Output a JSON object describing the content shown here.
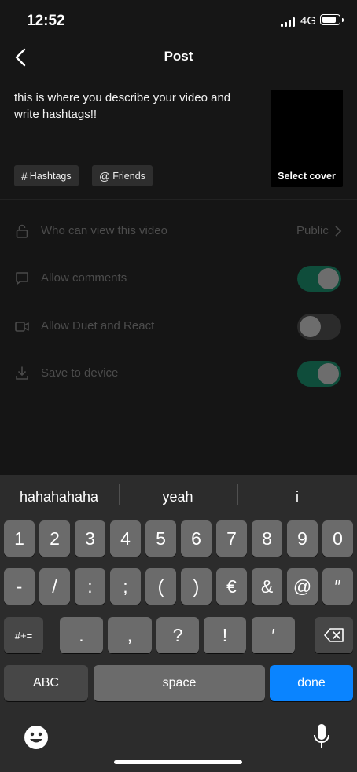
{
  "status_bar": {
    "time": "12:52",
    "network": "4G"
  },
  "header": {
    "title": "Post"
  },
  "description": "this is where you describe your video and write hashtags!!",
  "cover": {
    "label": "Select cover"
  },
  "chips": {
    "hashtags": {
      "symbol": "#",
      "label": "Hashtags"
    },
    "friends": {
      "symbol": "@",
      "label": "Friends"
    }
  },
  "settings": {
    "who_can_view": {
      "label": "Who can view this video",
      "value": "Public"
    },
    "allow_comments": {
      "label": "Allow comments",
      "on": true
    },
    "allow_duet": {
      "label": "Allow Duet and React",
      "on": false
    },
    "save_device": {
      "label": "Save to device",
      "on": true
    }
  },
  "keyboard": {
    "suggestions": [
      "hahahahaha",
      "yeah",
      "i"
    ],
    "row1": [
      "1",
      "2",
      "3",
      "4",
      "5",
      "6",
      "7",
      "8",
      "9",
      "0"
    ],
    "row2": [
      "-",
      "/",
      ":",
      ";",
      "(",
      ")",
      "€",
      "&",
      "@",
      "″"
    ],
    "row3": [
      ".",
      ",",
      "?",
      "!",
      "′"
    ],
    "symbols_key": "#+=",
    "abc_key": "ABC",
    "space_key": "space",
    "done_key": "done"
  },
  "colors": {
    "accent_done": "#0a84ff",
    "toggle_on": "#0f4d3b"
  }
}
